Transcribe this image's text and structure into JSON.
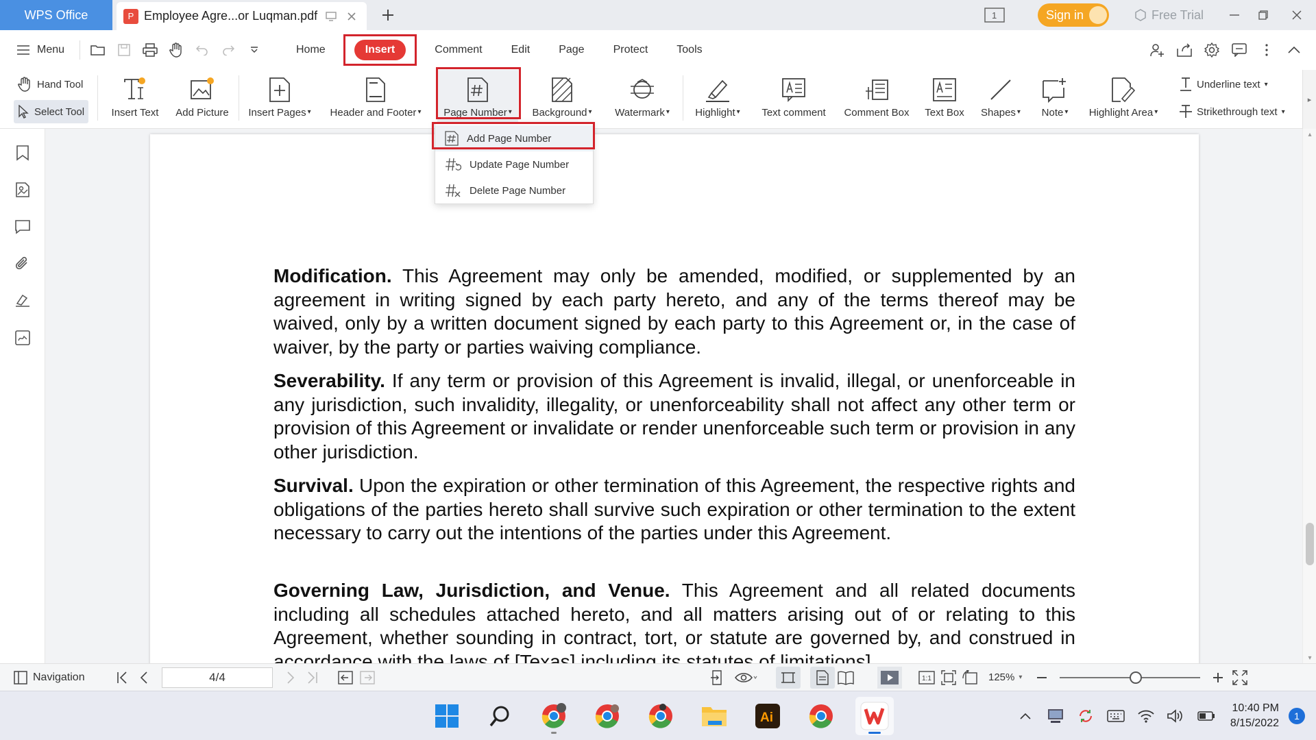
{
  "titlebar": {
    "app_tab": "WPS Office",
    "doc_tab": "Employee Agre...or Luqman.pdf",
    "page_count_badge": "1",
    "sign_in": "Sign in",
    "free_trial": "Free Trial"
  },
  "menubar": {
    "menu_label": "Menu",
    "tabs": [
      "Home",
      "Insert",
      "Comment",
      "Edit",
      "Page",
      "Protect",
      "Tools"
    ],
    "active_tab": "Insert"
  },
  "ribbon": {
    "hand_tool": "Hand Tool",
    "select_tool": "Select Tool",
    "buttons": [
      "Insert Text",
      "Add Picture",
      "Insert Pages",
      "Header and Footer",
      "Page Number",
      "Background",
      "Watermark",
      "Highlight",
      "Text comment",
      "Comment Box",
      "Text Box",
      "Shapes",
      "Note",
      "Highlight Area"
    ],
    "underline_text": "Underline text",
    "strikethrough_text": "Strikethrough text"
  },
  "dropdown": {
    "items": [
      "Add Page Number",
      "Update Page Number",
      "Delete Page Number"
    ]
  },
  "document": {
    "p1_head": "Modification.",
    "p1_body": "This Agreement may only be amended, modified, or supplemented by an agreement in writing signed by each party hereto, and any of the terms thereof may be waived, only by a written document signed by each party to this Agreement or, in the case of waiver, by the party or parties waiving compliance.",
    "p2_head": "Severability.",
    "p2_body": "If any term or provision of this Agreement is invalid, illegal, or unenforceable in any jurisdiction, such invalidity, illegality, or unenforceability shall not affect any other term or provision of this Agreement or invalidate or render unenforceable such term or provision in any other jurisdiction.",
    "p3_head": "Survival.",
    "p3_body": "Upon the expiration or other termination of this Agreement, the respective rights and obligations of the parties hereto shall survive such expiration or other termination to the extent necessary to carry out the intentions of the parties under this Agreement.",
    "p4_head": "Governing Law, Jurisdiction, and Venue.",
    "p4_body": "This Agreement and all related documents including all schedules attached hereto, and all matters arising out of or relating to this Agreement, whether sounding in contract, tort, or statute are governed by, and construed in accordance with the laws of [Texas] including its statutes of limitations]"
  },
  "statusbar": {
    "navigation": "Navigation",
    "page_indicator": "4/4",
    "zoom": "125%"
  },
  "taskbar": {
    "time": "10:40 PM",
    "date": "8/15/2022",
    "notifications": "1"
  },
  "colors": {
    "accent_red": "#e53935",
    "highlight_box": "#d3242c",
    "app_tab_blue": "#4a90e2",
    "sign_in_orange": "#f5a623"
  }
}
